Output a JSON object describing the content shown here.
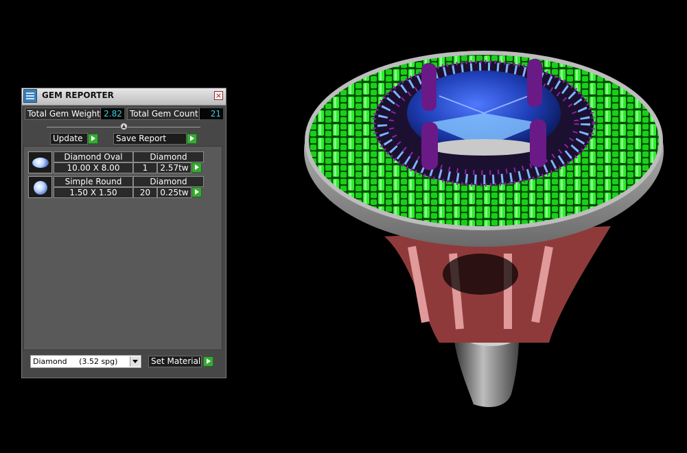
{
  "panel": {
    "title": "GEM REPORTER",
    "total_weight_label": "Total Gem Weight",
    "total_weight_value": "2.82",
    "total_count_label": "Total Gem Count",
    "total_count_value": "21",
    "update_label": "Update",
    "save_report_label": "Save Report"
  },
  "gems": [
    {
      "shape": "Diamond Oval",
      "material": "Diamond",
      "size": "10.00 X 8.00",
      "count": "1",
      "weight": "2.57tw"
    },
    {
      "shape": "Simple Round",
      "material": "Diamond",
      "size": "1.50 X 1.50",
      "count": "20",
      "weight": "0.25tw"
    }
  ],
  "material": {
    "selected_name": "Diamond",
    "selected_density": "(3.52 spg)",
    "set_button_label": "Set Material"
  },
  "icons": {
    "app": "gem-reporter-app-icon",
    "close": "close-icon",
    "go": "green-arrow-icon",
    "dropdown": "dropdown-arrow-icon"
  },
  "colors": {
    "panel_bg": "#474747",
    "value_text": "#39d0e0",
    "go_button": "#39a935",
    "viewport_bg": "#000000",
    "pave_metal": "#19e619",
    "center_stone": "#1f3fb8",
    "prongs": "#6a1a86",
    "shank": "#9a9a9a",
    "gallery": "#b85a5a"
  }
}
